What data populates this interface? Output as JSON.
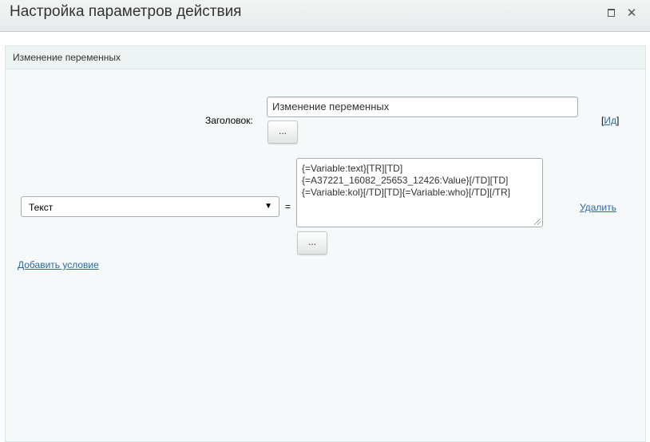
{
  "dialog": {
    "title": "Настройка параметров действия",
    "maximize_icon": "maximize-icon",
    "close_symbol": "✕"
  },
  "panel": {
    "title": "Изменение переменных"
  },
  "form": {
    "heading_label": "Заголовок:",
    "heading_value": "Изменение переменных",
    "dots_label": "...",
    "id_link_prefix": "[",
    "id_link_text": "Ид",
    "id_link_suffix": "]"
  },
  "condition": {
    "variable_selected": "Текст",
    "select_arrow": "▼",
    "equals": "=",
    "value_lines": [
      "{=Variable:text}[TR][TD]",
      "{=A37221_16082_25653_12426:Value}[/TD][TD]",
      "{=Variable:kol}[/TD][TD]{=Variable:who}[/TD][/TR]"
    ],
    "dots_label": "...",
    "delete_link": "Удалить"
  },
  "add_condition_link": "Добавить условие"
}
